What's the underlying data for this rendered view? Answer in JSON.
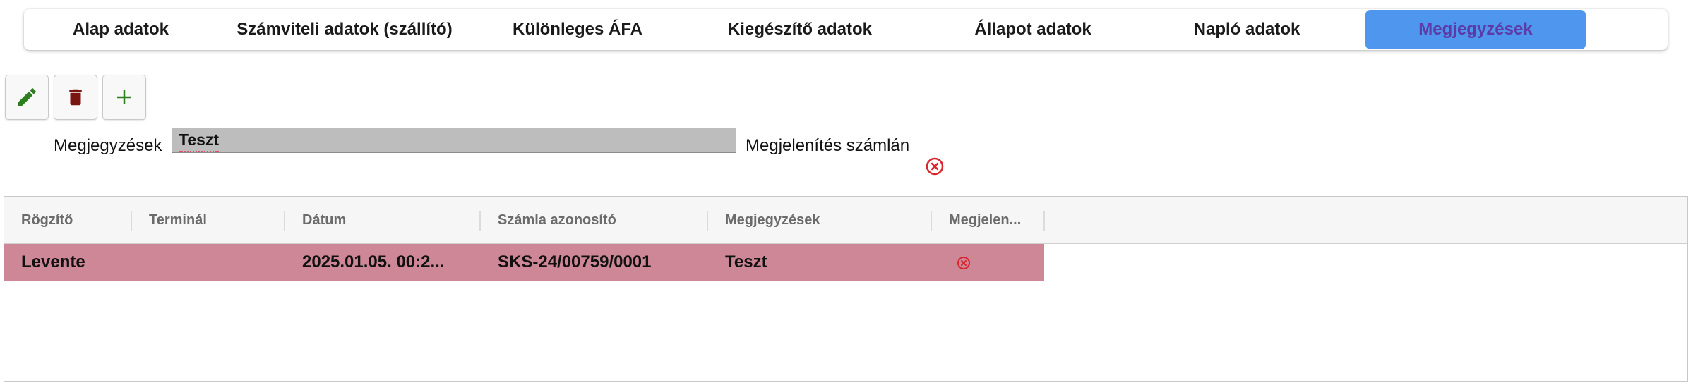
{
  "tabs": [
    {
      "label": "Alap adatok"
    },
    {
      "label": "Számviteli adatok (szállító)"
    },
    {
      "label": "Különleges ÁFA"
    },
    {
      "label": "Kiegészítő adatok"
    },
    {
      "label": "Állapot adatok"
    },
    {
      "label": "Napló adatok"
    },
    {
      "label": "Megjegyzések",
      "active": true
    }
  ],
  "toolbar": {
    "edit_icon": "pencil-icon",
    "delete_icon": "trash-icon",
    "add_icon": "plus-icon"
  },
  "form": {
    "notes_label": "Megjegyzések",
    "notes_value": "Teszt",
    "display_on_invoice_label": "Megjelenítés számlán",
    "display_on_invoice_icon": "x-circle-icon"
  },
  "grid": {
    "columns": [
      "Rögzítő",
      "Terminál",
      "Dátum",
      "Számla azonosító",
      "Megjegyzések",
      "Megjelen..."
    ],
    "rows": [
      {
        "recorder": "Levente",
        "terminal": "",
        "date": "2025.01.05. 00:2...",
        "invoice_id": "SKS-24/00759/0001",
        "notes": "Teszt",
        "display_icon": "x-circle-icon"
      }
    ]
  },
  "colors": {
    "active_tab": "#4f97ee",
    "active_tab_text": "#5c3aa8",
    "selected_row": "#ce8796",
    "edit_icon": "#2e7d1f",
    "delete_icon": "#7a1410",
    "add_icon": "#2e7d1f",
    "status_icon": "#d9252b"
  }
}
